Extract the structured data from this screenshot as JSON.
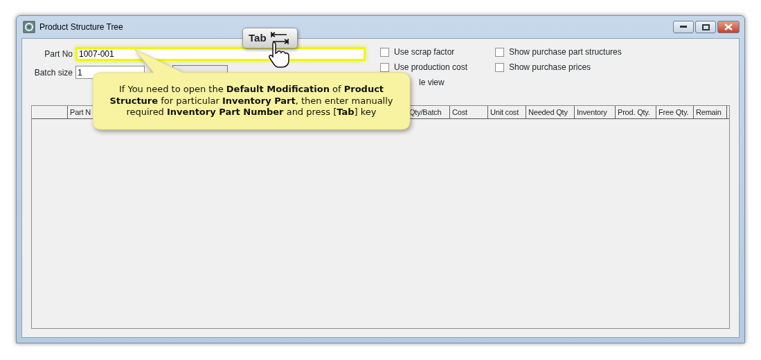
{
  "window": {
    "title": "Product Structure Tree"
  },
  "form": {
    "part_no": {
      "label": "Part No",
      "value": "1007-001"
    },
    "batch_size": {
      "label": "Batch size",
      "value": "1"
    }
  },
  "options": [
    {
      "label": "Use scrap factor",
      "checked": false
    },
    {
      "label": "Show purchase part structures",
      "checked": false
    },
    {
      "label": "Use production cost",
      "checked": false
    },
    {
      "label": "Show purchase prices",
      "checked": false
    }
  ],
  "partial_option": {
    "label": "le view"
  },
  "table": {
    "columns": [
      "",
      "Part N",
      "Qty/Batch",
      "Cost",
      "Unit cost",
      "Needed Qty",
      "Inventory",
      "Prod. Qty.",
      "Free Qty.",
      "Remain"
    ]
  },
  "key_hint": {
    "label": "Tab"
  },
  "callout": {
    "lines": [
      "If You need to open the **Default Modification** of **Product**",
      "**Structure** for particular **Inventory Part**, then enter manually",
      "required **Inventory Part Number** and press [**Tab**] key"
    ]
  }
}
